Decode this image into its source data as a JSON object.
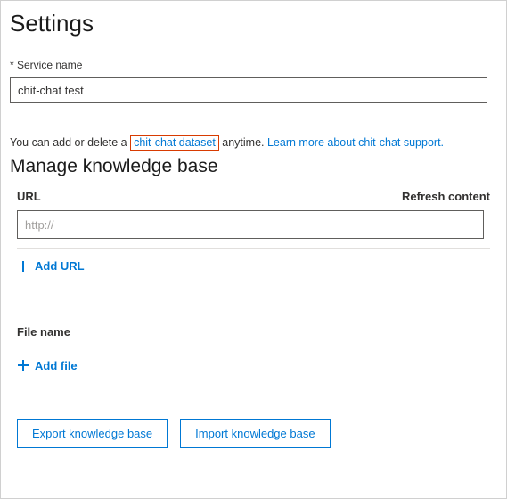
{
  "page": {
    "title": "Settings",
    "manage_title": "Manage knowledge base"
  },
  "service_name": {
    "label": "* Service name",
    "value": "chit-chat test"
  },
  "info": {
    "prefix": "You can add or delete a ",
    "highlight_link": "chit-chat dataset",
    "middle": " anytime. ",
    "learn_more": "Learn more about chit-chat support."
  },
  "url_section": {
    "header": "URL",
    "refresh": "Refresh content",
    "placeholder": "http://",
    "add_label": "Add URL"
  },
  "file_section": {
    "header": "File name",
    "add_label": "Add file"
  },
  "buttons": {
    "export": "Export knowledge base",
    "import": "Import knowledge base"
  }
}
